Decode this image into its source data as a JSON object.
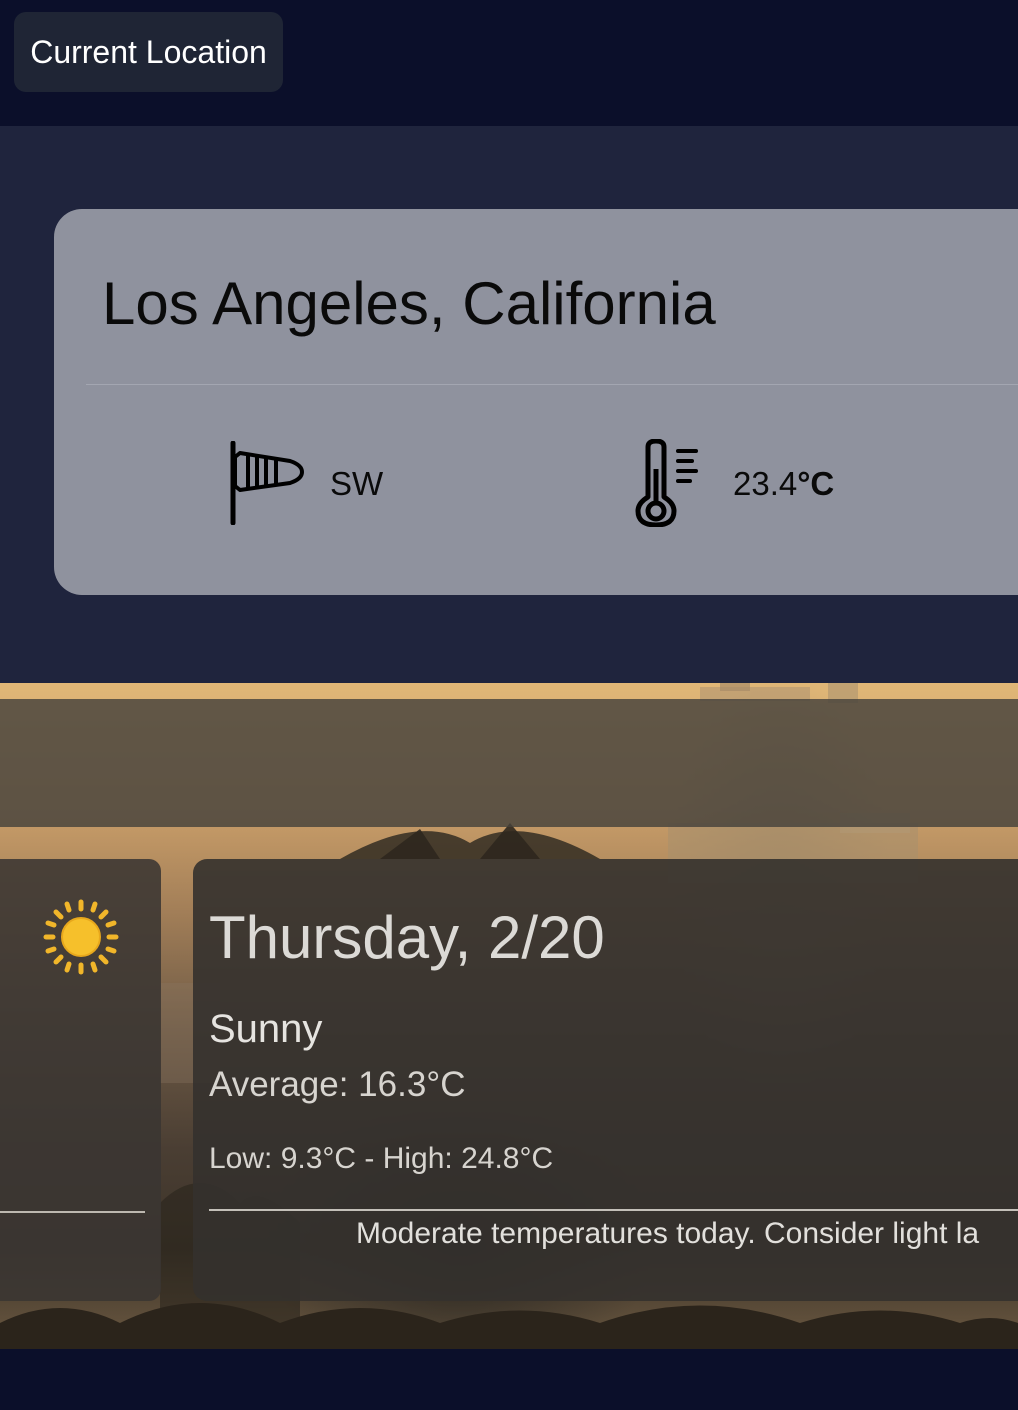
{
  "header": {
    "current_location_label": "Current Location"
  },
  "current": {
    "city": "Los Angeles, California",
    "wind_direction": "SW",
    "temperature_value": "23.4",
    "temperature_unit": "°C",
    "wind_icon": "windsock-icon",
    "temperature_icon": "thermometer-icon"
  },
  "forecast": {
    "day_title": "Thursday, 2/20",
    "condition": "Sunny",
    "average": "Average: 16.3°C",
    "low_high": "Low: 9.3°C - High: 24.8°C",
    "advice": "Moderate temperatures today. Consider light la",
    "weather_icon": "sun-icon"
  },
  "colors": {
    "page_bg": "#0b0f2a",
    "section_bg": "#1f243d",
    "current_card_bg": "#8f929e",
    "button_bg": "#1f2535",
    "sun": "#f6c02b"
  }
}
